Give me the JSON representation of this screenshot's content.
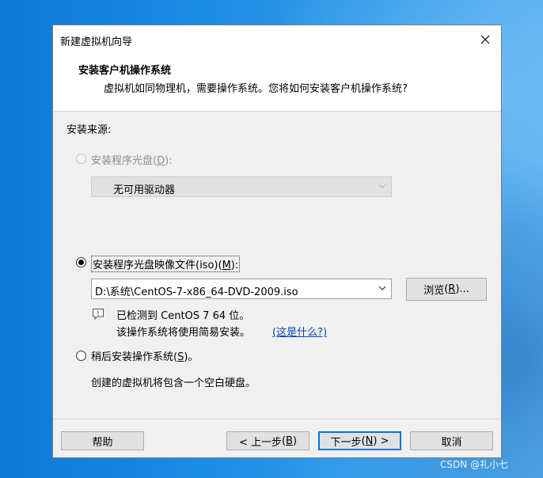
{
  "window": {
    "title": "新建虚拟机向导"
  },
  "header": {
    "title": "安装客户机操作系统",
    "subtitle": "虚拟机如同物理机，需要操作系统。您将如何安装客户机操作系统?"
  },
  "install_source": {
    "label": "安装来源:",
    "disc_option": {
      "text": "安装程序光盘",
      "mnemonic": "D",
      "prefix": "(",
      "suffix": "):",
      "selected": false,
      "enabled": false
    },
    "disc_drive": {
      "value": "无可用驱动器"
    },
    "iso_option": {
      "text": "安装程序光盘映像文件(iso)",
      "mnemonic": "M",
      "prefix": "(",
      "suffix": "):",
      "selected": true
    },
    "iso_path": {
      "value": "D:\\系统\\CentOS-7-x86_64-DVD-2009.iso"
    },
    "browse_button": {
      "text": "浏览",
      "mnemonic": "R",
      "prefix": "(",
      "suffix": ")..."
    },
    "detected_line": "已检测到 CentOS 7 64 位。",
    "easy_install_line": "该操作系统将使用简易安装。",
    "what_is_this_link": "(这是什么?)",
    "later_option": {
      "text": "稍后安装操作系统",
      "mnemonic": "S",
      "prefix": "(",
      "suffix": ")。",
      "selected": false
    },
    "later_desc": "创建的虚拟机将包含一个空白硬盘。"
  },
  "footer": {
    "help": "帮助",
    "back": {
      "text": "< 上一步",
      "mnemonic": "B",
      "prefix": "(",
      "suffix": ")"
    },
    "next": {
      "text": "下一步",
      "mnemonic": "N",
      "prefix": "(",
      "suffix": ") >"
    },
    "cancel": "取消"
  },
  "watermark": "CSDN @礼小七",
  "colors": {
    "desktop": "#1e8de4",
    "link": "#0645ad",
    "default_button_border": "#0078d7"
  }
}
